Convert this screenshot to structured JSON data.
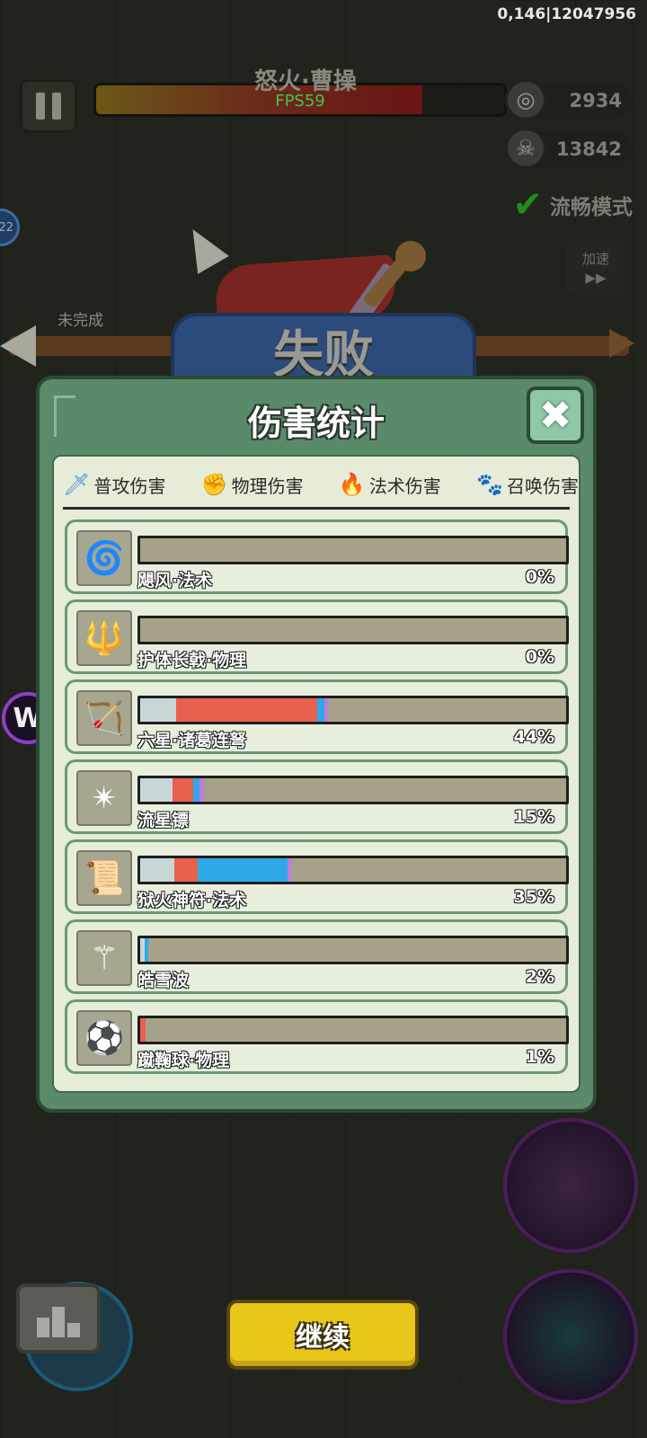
{
  "hud": {
    "debug_text": "0,146|12047956",
    "boss_name": "怒火·曹操",
    "boss_hp_fraction": 0.8,
    "fps": "FPS59",
    "coins": "2934",
    "kills": "13842",
    "smooth_mode": "流畅模式",
    "speed_label": "加速",
    "speed_glyph": "▶▶",
    "side_badge": "22",
    "incomplete_label": "未完成"
  },
  "defeat": {
    "title": "失败"
  },
  "panel": {
    "title": "伤害统计",
    "close_glyph": "✖",
    "tabs": [
      {
        "label": "普攻伤害",
        "icon": "sword-icon",
        "glyph": "🗡",
        "color": "#4a8ed8"
      },
      {
        "label": "物理伤害",
        "icon": "fist-icon",
        "glyph": "✊",
        "color": "#d8343a"
      },
      {
        "label": "法术伤害",
        "icon": "flame-icon",
        "glyph": "🔥",
        "color": "#2d7fe0"
      },
      {
        "label": "召唤伤害",
        "icon": "paw-icon",
        "glyph": "🐾",
        "color": "#b43cd0"
      }
    ],
    "segment_colors": {
      "normal": "#c7d7d6",
      "physical": "#e8604e",
      "magic": "#2fa8e8",
      "summon": "#c27ae0"
    },
    "rows": [
      {
        "name": "飓风·法术",
        "pct": "0%",
        "icon": "tornado-icon",
        "glyph": "🌀",
        "segments": []
      },
      {
        "name": "护体长戟·物理",
        "pct": "0%",
        "icon": "halberd-icon",
        "glyph": "🔱",
        "segments": []
      },
      {
        "name": "六星·诸葛连弩",
        "pct": "44%",
        "icon": "crossbow-icon",
        "glyph": "🏹",
        "segments": [
          [
            "normal",
            0.085
          ],
          [
            "physical",
            0.33
          ],
          [
            "magic",
            0.018
          ],
          [
            "summon",
            0.007
          ]
        ]
      },
      {
        "name": "流星镖",
        "pct": "15%",
        "icon": "shuriken-icon",
        "glyph": "✴",
        "segments": [
          [
            "normal",
            0.075
          ],
          [
            "physical",
            0.05
          ],
          [
            "magic",
            0.015
          ],
          [
            "summon",
            0.01
          ]
        ]
      },
      {
        "name": "狱火神符·法术",
        "pct": "35%",
        "icon": "rune-icon",
        "glyph": "📜",
        "segments": [
          [
            "normal",
            0.08
          ],
          [
            "physical",
            0.055
          ],
          [
            "magic",
            0.21
          ],
          [
            "summon",
            0.01
          ]
        ]
      },
      {
        "name": "皓雪波",
        "pct": "2%",
        "icon": "scepter-icon",
        "glyph": "⚚",
        "segments": [
          [
            "normal",
            0.01
          ],
          [
            "magic",
            0.008
          ]
        ]
      },
      {
        "name": "蹴鞠球·物理",
        "pct": "1%",
        "icon": "ball-icon",
        "glyph": "⚽",
        "segments": [
          [
            "physical",
            0.012
          ]
        ]
      }
    ]
  },
  "bottom": {
    "continue_label": "继续"
  }
}
